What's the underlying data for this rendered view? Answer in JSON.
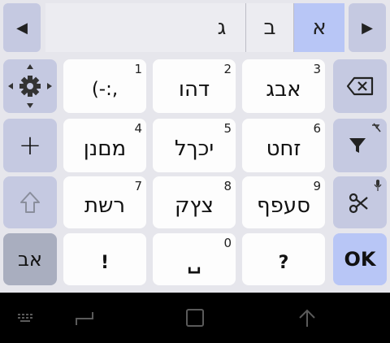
{
  "candidates": {
    "left_arrow": "◀",
    "right_arrow": "▶",
    "items": [
      "ג",
      "ב",
      "א"
    ],
    "selected_index": 2
  },
  "keys": {
    "r1": {
      "emoticon": {
        "num": "1",
        "label": "(-:,"
      },
      "k2": {
        "num": "2",
        "label": "דהו"
      },
      "k3": {
        "num": "3",
        "label": "אבג"
      }
    },
    "r2": {
      "k4": {
        "num": "4",
        "label": "מםנן"
      },
      "k5": {
        "num": "5",
        "label": "יכךל"
      },
      "k6": {
        "num": "6",
        "label": "זחט"
      }
    },
    "r3": {
      "k7": {
        "num": "7",
        "label": "רשת"
      },
      "k8": {
        "num": "8",
        "label": "צץק"
      },
      "k9": {
        "num": "9",
        "label": "סעפף"
      }
    },
    "r4": {
      "lang": {
        "label": "אב"
      },
      "excl": {
        "label": "!"
      },
      "space": {
        "num": "0",
        "label": "␣"
      },
      "question": {
        "label": "?"
      },
      "ok": {
        "label": "OK"
      }
    },
    "plus": "+"
  },
  "icons": {
    "settings": "gear-icon",
    "backspace": "backspace-icon",
    "filter": "filter-icon",
    "shift": "shift-arrow-icon",
    "cut": "scissors-icon",
    "mic": "mic-icon"
  },
  "colors": {
    "background": "#e6e6ec",
    "key_white": "#fdfdfd",
    "key_side": "#c5c9e1",
    "key_ok": "#b8c6f6",
    "key_lang": "#a9aebf",
    "candidate_selected": "#b8c6f6"
  }
}
